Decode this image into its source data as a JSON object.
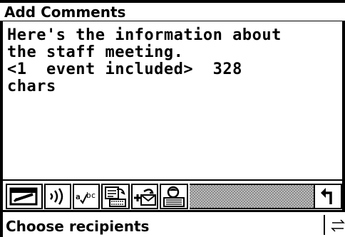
{
  "window": {
    "title": "Add Comments"
  },
  "comment": {
    "lines": [
      "Here's the information about",
      "the staff meeting.",
      "<1  event included>  328",
      "chars"
    ]
  },
  "toolbar": {
    "buttons": [
      {
        "icon": "note-pad-icon"
      },
      {
        "icon": "speaker-icon"
      },
      {
        "icon": "spell-check-icon"
      },
      {
        "icon": "address-book-icon"
      },
      {
        "icon": "attach-envelope-icon"
      },
      {
        "icon": "contact-card-icon"
      },
      {
        "icon": "return-arrow-icon"
      }
    ]
  },
  "status": {
    "text": "Choose recipients",
    "switch_icon": "switch-arrows-icon"
  }
}
